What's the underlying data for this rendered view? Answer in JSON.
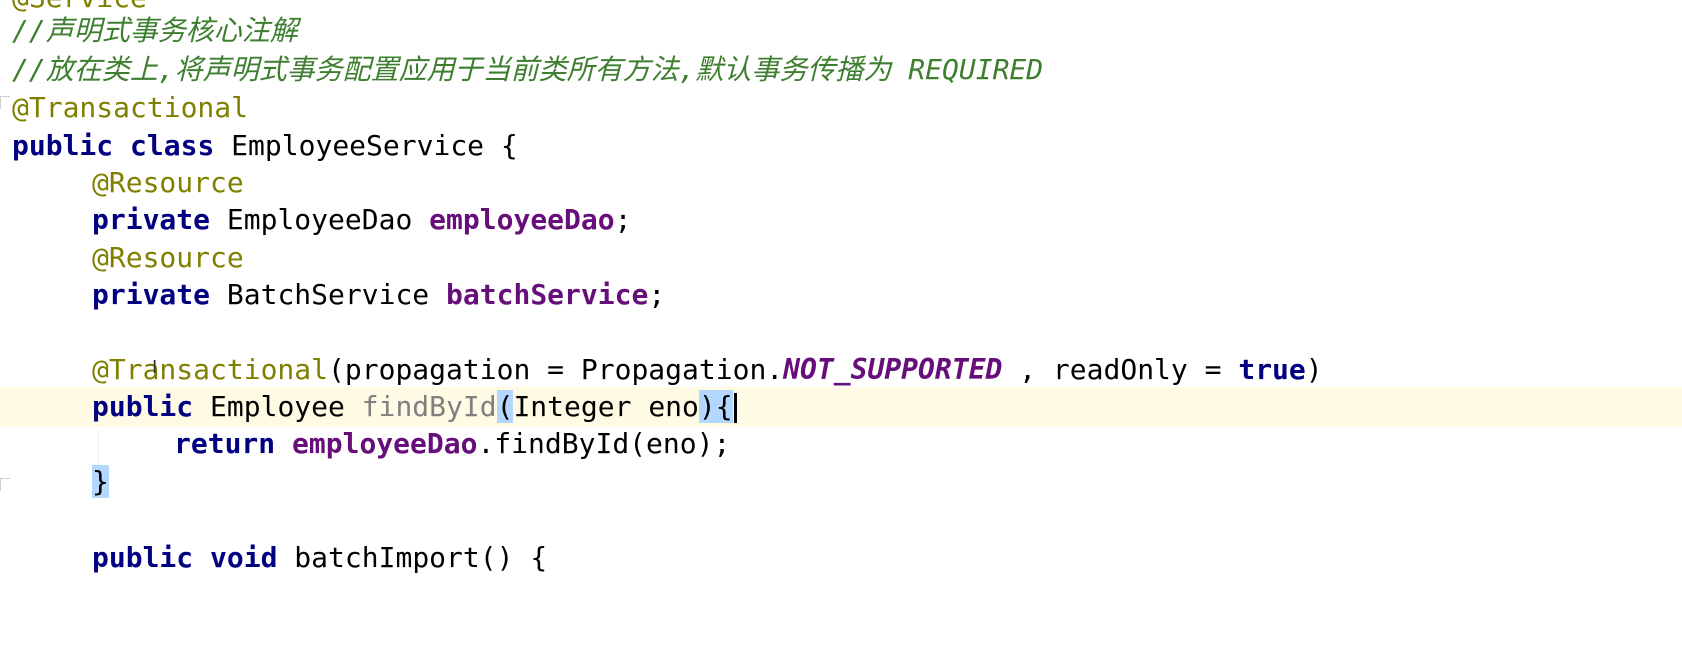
{
  "editor": {
    "lines": [
      {
        "id": "l0",
        "segments": [
          {
            "t": "@Service",
            "c": "ann"
          }
        ]
      },
      {
        "id": "l1",
        "segments": [
          {
            "t": "//声明式事务核心注解",
            "c": "cmt"
          }
        ]
      },
      {
        "id": "l2",
        "segments": [
          {
            "t": "//放在类上,将声明式事务配置应用于当前类所有方法,默认事务传播为 REQUIRED",
            "c": "cmt"
          }
        ]
      },
      {
        "id": "l3",
        "segments": [
          {
            "t": "@Transactional",
            "c": "ann"
          }
        ]
      },
      {
        "id": "l4",
        "segments": [
          {
            "t": "public",
            "c": "kw"
          },
          {
            "t": " "
          },
          {
            "t": "class",
            "c": "kw"
          },
          {
            "t": " EmployeeService {"
          }
        ]
      },
      {
        "id": "l5",
        "segments": [
          {
            "t": "@Resource",
            "c": "ann"
          }
        ]
      },
      {
        "id": "l6",
        "segments": [
          {
            "t": "private",
            "c": "kw"
          },
          {
            "t": " EmployeeDao "
          },
          {
            "t": "employeeDao",
            "c": "field"
          },
          {
            "t": ";"
          }
        ]
      },
      {
        "id": "l7",
        "segments": [
          {
            "t": "@Resource",
            "c": "ann"
          }
        ]
      },
      {
        "id": "l8",
        "segments": [
          {
            "t": "private",
            "c": "kw"
          },
          {
            "t": " BatchService "
          },
          {
            "t": "batchService",
            "c": "field"
          },
          {
            "t": ";"
          }
        ]
      },
      {
        "id": "l10",
        "segments": [
          {
            "t": "@Transactional",
            "c": "ann"
          },
          {
            "t": "(propagation = Propagation."
          },
          {
            "t": "NOT_SUPPORTED",
            "c": "const"
          },
          {
            "t": " , readOnly = "
          },
          {
            "t": "true",
            "c": "kw"
          },
          {
            "t": ")"
          }
        ]
      },
      {
        "id": "l11",
        "segments": [
          {
            "t": "public",
            "c": "kw"
          },
          {
            "t": " Employee "
          },
          {
            "t": "findById",
            "c": "unused"
          },
          {
            "t": "(",
            "c": "match"
          },
          {
            "t": "Integer eno"
          },
          {
            "t": ")",
            "c": "match"
          },
          {
            "t": "{",
            "c": "match"
          }
        ]
      },
      {
        "id": "l12",
        "segments": [
          {
            "t": "return",
            "c": "kw"
          },
          {
            "t": " "
          },
          {
            "t": "employeeDao",
            "c": "field"
          },
          {
            "t": ".findById(eno);"
          }
        ]
      },
      {
        "id": "l13",
        "segments": [
          {
            "t": "}",
            "c": "match"
          }
        ]
      },
      {
        "id": "l15",
        "segments": [
          {
            "t": "public",
            "c": "kw"
          },
          {
            "t": " "
          },
          {
            "t": "void",
            "c": "kw"
          },
          {
            "t": " batchImport() {"
          }
        ]
      }
    ]
  }
}
